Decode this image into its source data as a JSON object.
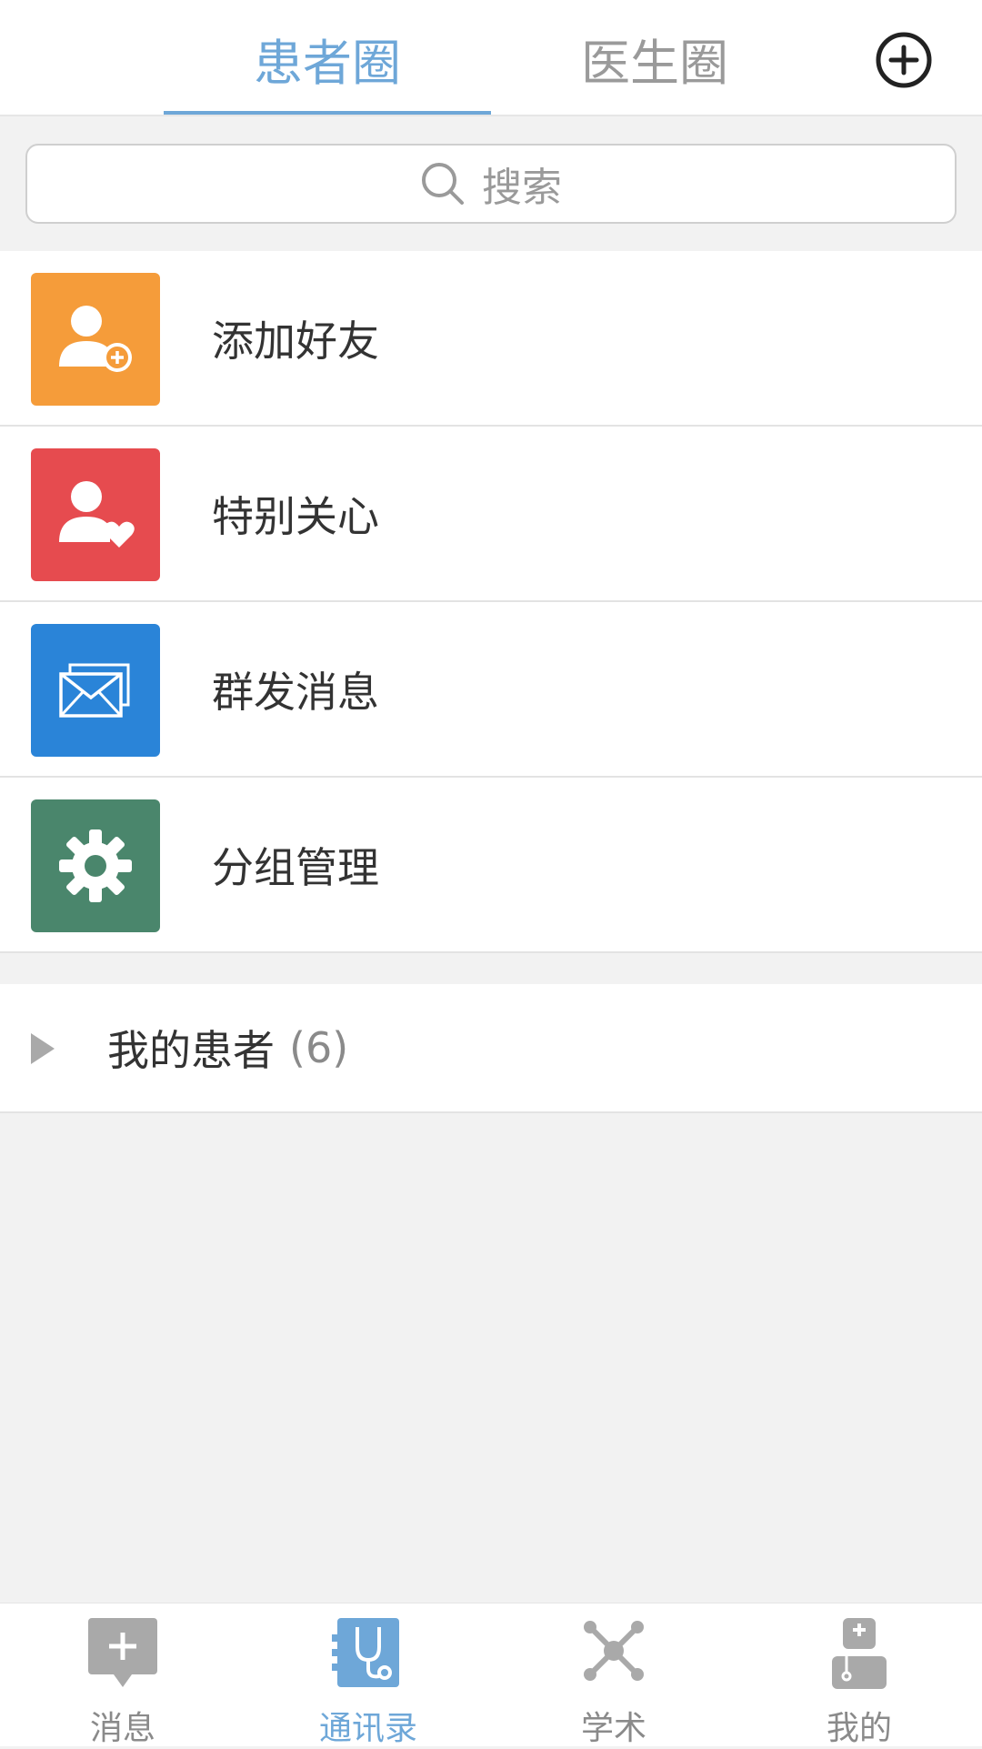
{
  "header": {
    "tabs": [
      {
        "label": "患者圈",
        "active": true
      },
      {
        "label": "医生圈",
        "active": false
      }
    ],
    "add_icon": "plus-circle-icon",
    "active_color": "#6ea7d8"
  },
  "search": {
    "placeholder": "搜索",
    "icon": "search-icon"
  },
  "menu": {
    "items": [
      {
        "label": "添加好友",
        "icon": "add-user-icon",
        "color": "#f59c3a"
      },
      {
        "label": "特别关心",
        "icon": "user-heart-icon",
        "color": "#e64b4f"
      },
      {
        "label": "群发消息",
        "icon": "envelope-icon",
        "color": "#2a84d8"
      },
      {
        "label": "分组管理",
        "icon": "gear-icon",
        "color": "#4a866c"
      }
    ]
  },
  "groups": [
    {
      "name": "我的患者",
      "count": "(6)"
    }
  ],
  "bottom_nav": {
    "items": [
      {
        "label": "消息",
        "icon": "message-icon",
        "active": false
      },
      {
        "label": "通讯录",
        "icon": "stethoscope-icon",
        "active": true
      },
      {
        "label": "学术",
        "icon": "network-icon",
        "active": false
      },
      {
        "label": "我的",
        "icon": "doctor-icon",
        "active": false
      }
    ]
  }
}
